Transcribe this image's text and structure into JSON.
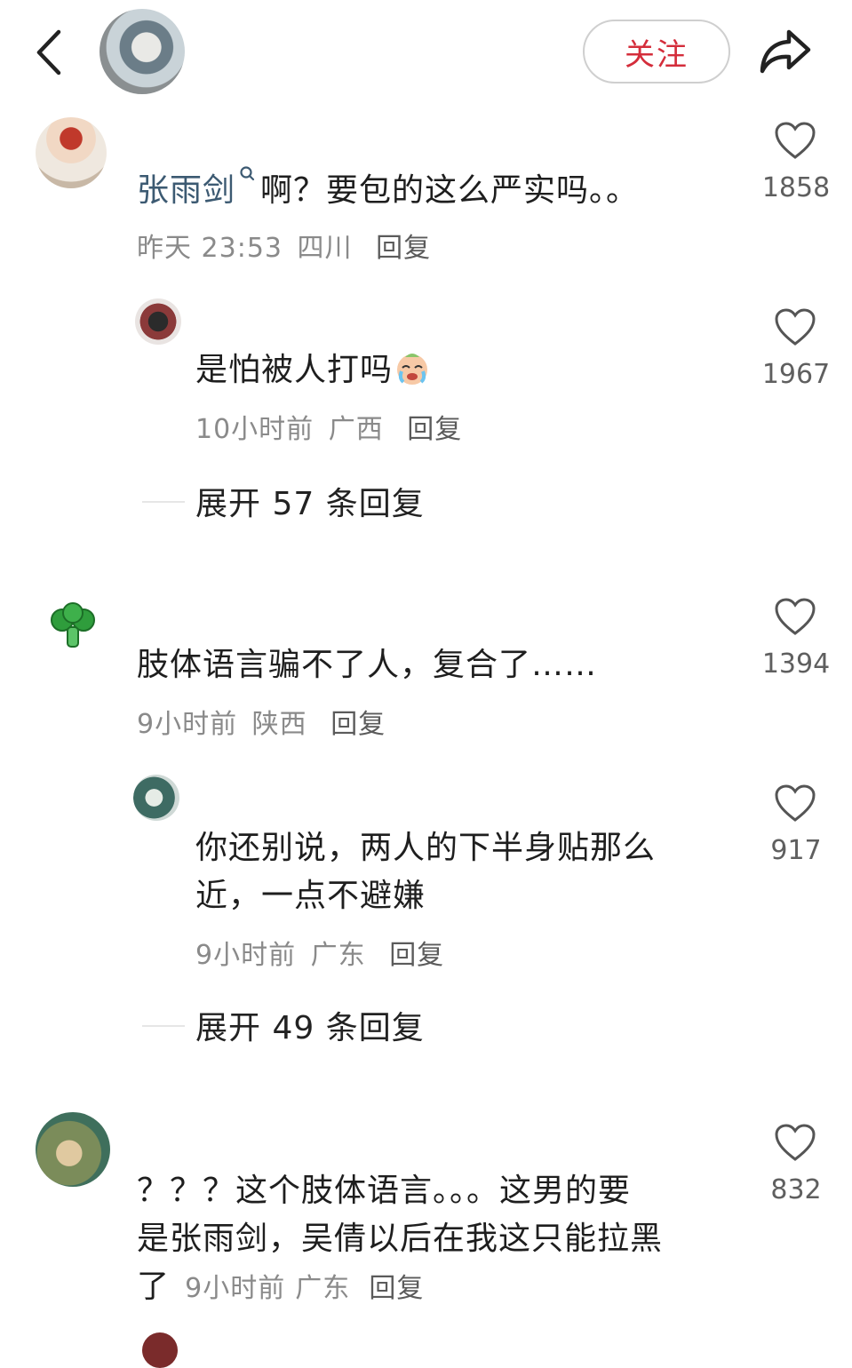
{
  "header": {
    "follow_label": "关注"
  },
  "comments": [
    {
      "user": "张雨剑",
      "text": "啊？要包的这么严实吗。。",
      "time": "昨天 23:53",
      "location": "四川",
      "reply": "回复",
      "likes": "1858"
    },
    {
      "text": "是怕被人打吗",
      "time": "10小时前",
      "location": "广西",
      "reply": "回复",
      "likes": "1967"
    },
    {
      "expand": "展开 57 条回复"
    },
    {
      "text": "肢体语言骗不了人，复合了……",
      "time": "9小时前",
      "location": "陕西",
      "reply": "回复",
      "likes": "1394"
    },
    {
      "text_line1": "你还别说，两人的下半身贴那么",
      "text_line2": "近，一点不避嫌",
      "time": "9小时前",
      "location": "广东",
      "reply": "回复",
      "likes": "917"
    },
    {
      "expand": "展开 49 条回复"
    },
    {
      "text_line1": "？？？这个肢体语言。。。这男的要",
      "text_line2": "是张雨剑，吴倩以后在我这只能拉黑",
      "text_line3": "了",
      "time": "9小时前",
      "location": "广东",
      "reply": "回复",
      "likes": "832"
    }
  ],
  "icons": {
    "back": "chevron-left",
    "share": "share-arrow",
    "like": "heart-outline",
    "emoji": "crying-face",
    "avatar_badge": "broccoli",
    "user_badge": "search-magnifier"
  },
  "colors": {
    "follow": "#d42d3b",
    "username": "#3c5a72",
    "meta": "#8a8a8a"
  }
}
